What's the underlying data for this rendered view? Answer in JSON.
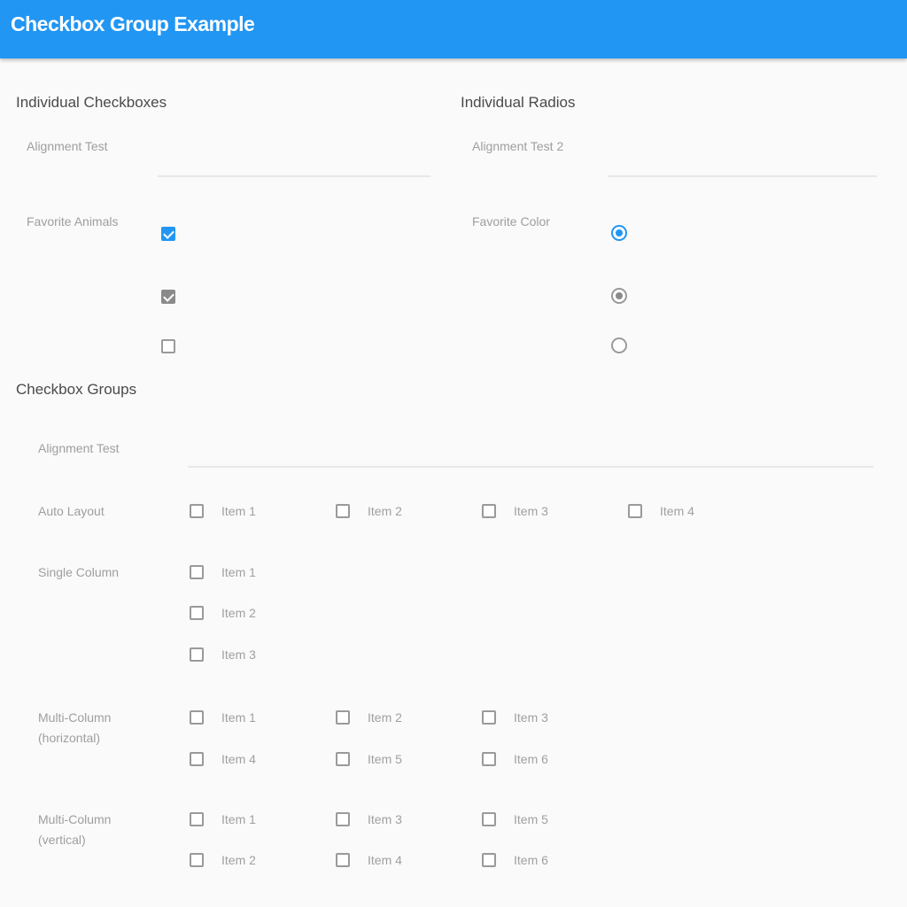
{
  "app": {
    "title": "Checkbox Group Example",
    "accent": "#2196f3"
  },
  "individual_checkboxes": {
    "title": "Individual Checkboxes",
    "alignment_label": "Alignment Test",
    "animals_label": "Favorite Animals",
    "checkboxes": [
      {
        "state": "checked",
        "color": "#2196f3"
      },
      {
        "state": "checked",
        "color": "#8a8a8a"
      },
      {
        "state": "unchecked"
      }
    ]
  },
  "individual_radios": {
    "title": "Individual Radios",
    "alignment_label": "Alignment Test 2",
    "color_label": "Favorite Color",
    "radios": [
      {
        "state": "selected",
        "color": "#2196f3"
      },
      {
        "state": "selected",
        "color": "#8a8a8a"
      },
      {
        "state": "unselected"
      }
    ]
  },
  "checkbox_groups": {
    "title": "Checkbox Groups",
    "alignment_label": "Alignment Test",
    "auto_layout": {
      "label": "Auto Layout",
      "items": [
        "Item 1",
        "Item 2",
        "Item 3",
        "Item 4"
      ]
    },
    "single_column": {
      "label": "Single Column",
      "items": [
        "Item 1",
        "Item 2",
        "Item 3"
      ]
    },
    "multi_horizontal": {
      "label_line1": "Multi-Column",
      "label_line2": "(horizontal)",
      "items": [
        "Item 1",
        "Item 2",
        "Item 3",
        "Item 4",
        "Item 5",
        "Item 6"
      ]
    },
    "multi_vertical": {
      "label_line1": "Multi-Column",
      "label_line2": "(vertical)",
      "items": [
        "Item 1",
        "Item 3",
        "Item 5",
        "Item 2",
        "Item 4",
        "Item 6"
      ]
    }
  }
}
